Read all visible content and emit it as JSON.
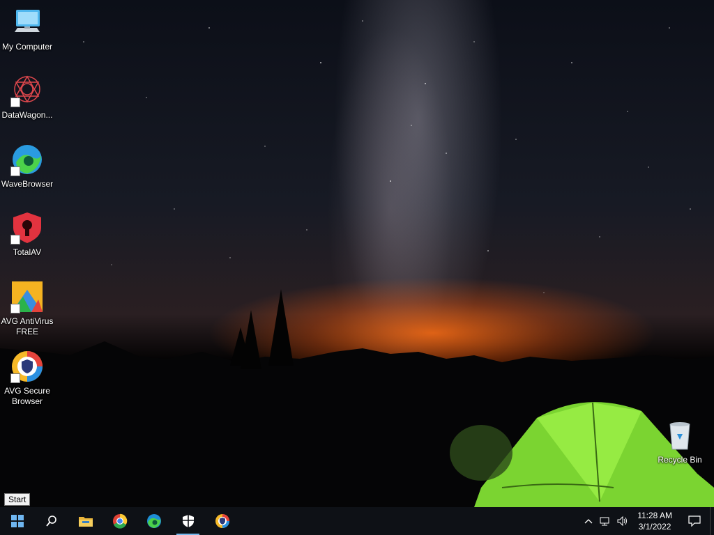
{
  "desktop": {
    "icons": [
      {
        "label": "My Computer",
        "icon": "computer-icon"
      },
      {
        "label": "DataWagon...",
        "icon": "datawagon-icon"
      },
      {
        "label": "WaveBrowser",
        "icon": "wavebrowser-icon"
      },
      {
        "label": "TotalAV",
        "icon": "totalav-icon"
      },
      {
        "label": "AVG AntiVirus FREE",
        "icon": "avg-antivirus-icon"
      },
      {
        "label": "AVG Secure Browser",
        "icon": "avg-secure-browser-icon"
      }
    ],
    "recycle_bin": {
      "label": "Recycle Bin",
      "icon": "recycle-bin-icon"
    }
  },
  "tooltip": {
    "text": "Start"
  },
  "taskbar": {
    "buttons": [
      {
        "name": "start",
        "icon": "windows-logo-icon"
      },
      {
        "name": "search",
        "icon": "search-icon"
      },
      {
        "name": "file-explorer",
        "icon": "folder-icon"
      },
      {
        "name": "chrome",
        "icon": "chrome-icon"
      },
      {
        "name": "edge",
        "icon": "edge-icon"
      },
      {
        "name": "security",
        "icon": "shield-icon",
        "active": true
      },
      {
        "name": "avg-secure-browser",
        "icon": "avg-browser-icon"
      }
    ],
    "tray": {
      "time": "11:28 AM",
      "date": "3/1/2022"
    }
  },
  "colors": {
    "taskbar": "#0e1116",
    "accent": "#76b9ed",
    "tent": "#8fe03a",
    "horizon": "#ff6e14"
  }
}
